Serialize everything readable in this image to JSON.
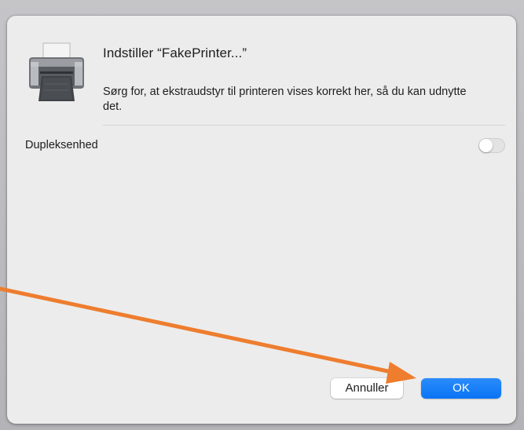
{
  "dialog": {
    "title": "Indstiller “FakePrinter...”",
    "description": "Sørg for, at ekstraudstyr til printeren vises korrekt her, så du kan udnytte det.",
    "icon": "printer-icon"
  },
  "options": {
    "duplex_label": "Dupleksenhed",
    "duplex_enabled": false
  },
  "buttons": {
    "cancel_label": "Annuller",
    "ok_label": "OK"
  },
  "colors": {
    "accent": "#0a74f5",
    "annotation_arrow": "#ee7d2e"
  }
}
